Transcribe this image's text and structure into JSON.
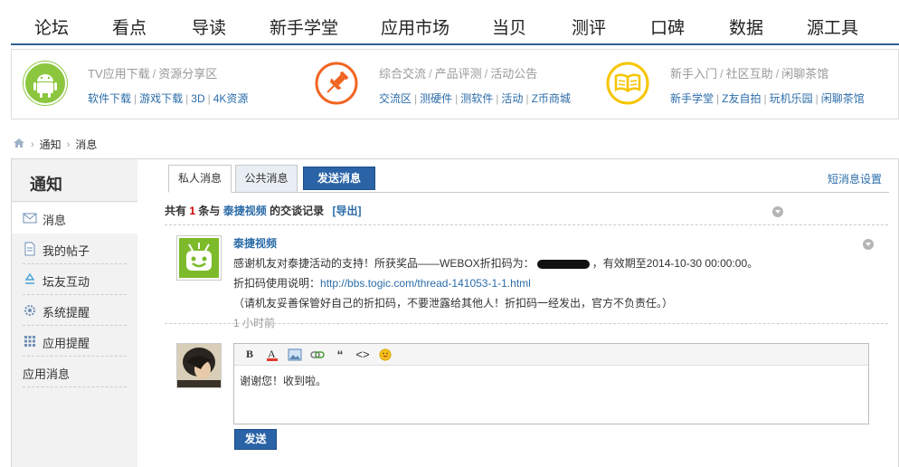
{
  "topnav": {
    "items": [
      "论坛",
      "看点",
      "导读",
      "新手学堂",
      "应用市场",
      "当贝",
      "测评",
      "口碑",
      "数据",
      "源工具"
    ]
  },
  "sections": [
    {
      "icon": "android-icon",
      "color": "#8cc63f",
      "title_parts": [
        "TV应用下载",
        "资源分享区"
      ],
      "links": [
        "软件下载",
        "游戏下载",
        "3D",
        "4K资源"
      ]
    },
    {
      "icon": "pushpin-icon",
      "color": "#f16522",
      "title_parts": [
        "综合交流",
        "产品评测",
        "活动公告"
      ],
      "links": [
        "交流区",
        "测硬件",
        "测软件",
        "活动",
        "Z币商城"
      ]
    },
    {
      "icon": "book-icon",
      "color": "#f7c500",
      "title_parts": [
        "新手入门",
        "社区互助",
        "闲聊茶馆"
      ],
      "links": [
        "新手学堂",
        "Z友自拍",
        "玩机乐园",
        "闲聊茶馆"
      ]
    }
  ],
  "breadcrumb": {
    "items": [
      "通知",
      "消息"
    ]
  },
  "sidebar": {
    "title": "通知",
    "items": [
      {
        "label": "消息",
        "icon": "envelope-icon"
      },
      {
        "label": "我的帖子",
        "icon": "document-icon"
      },
      {
        "label": "坛友互动",
        "icon": "recycle-icon"
      },
      {
        "label": "系统提醒",
        "icon": "gear-icon"
      },
      {
        "label": "应用提醒",
        "icon": "grid-icon"
      },
      {
        "label": "应用消息",
        "icon": ""
      }
    ]
  },
  "tabs": {
    "private": "私人消息",
    "public": "公共消息",
    "send": "发送消息",
    "settings": "短消息设置"
  },
  "summary": {
    "prefix": "共有",
    "count": "1",
    "mid": "条与",
    "user": "泰捷视频",
    "suffix": "的交谈记录",
    "export": "[导出]"
  },
  "message": {
    "sender": "泰捷视频",
    "line1_a": "感谢机友对泰捷活动的支持！所获奖品——WEBOX折扣码为：",
    "line1_b": "，有效期至2014-10-30 00:00:00。",
    "line2_label": "折扣码使用说明：",
    "line2_link": "http://bbs.togic.com/thread-141053-1-1.html",
    "line3": "（请机友妥善保管好自己的折扣码，不要泄露给其他人！折扣码一经发出，官方不负责任。）",
    "time": "1 小时前"
  },
  "editor": {
    "text": "谢谢您！收到啦。"
  },
  "send_button": "发送"
}
